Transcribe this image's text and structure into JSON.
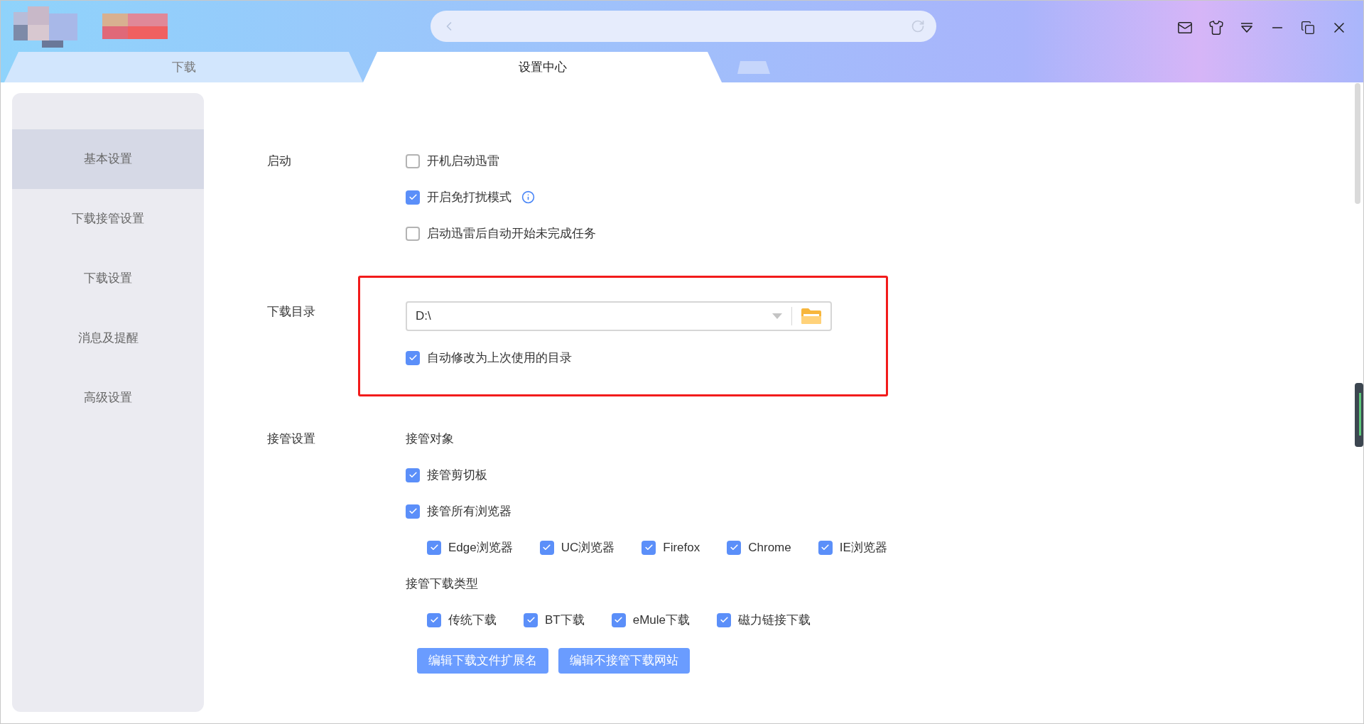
{
  "tabs": [
    {
      "label": "下载",
      "selected": false
    },
    {
      "label": "设置中心",
      "selected": true
    }
  ],
  "sidebar": {
    "items": [
      {
        "label": "基本设置",
        "selected": true
      },
      {
        "label": "下载接管设置",
        "selected": false
      },
      {
        "label": "下载设置",
        "selected": false
      },
      {
        "label": "消息及提醒",
        "selected": false
      },
      {
        "label": "高级设置",
        "selected": false
      }
    ]
  },
  "sections": [
    {
      "label": "启动",
      "highlighted": false,
      "rows": [
        {
          "kind": "checkbox",
          "label": "开机启动迅雷",
          "checked": false
        },
        {
          "kind": "checkbox",
          "label": "开启免打扰模式",
          "checked": true,
          "info": true
        },
        {
          "kind": "checkbox",
          "label": "启动迅雷后自动开始未完成任务",
          "checked": false
        }
      ]
    },
    {
      "label": "下载目录",
      "highlighted": true,
      "rows": [
        {
          "kind": "path",
          "value": "D:\\"
        },
        {
          "kind": "checkbox",
          "label": "自动修改为上次使用的目录",
          "checked": true
        }
      ]
    },
    {
      "label": "接管设置",
      "highlighted": false,
      "rows": [
        {
          "kind": "heading",
          "label": "接管对象"
        },
        {
          "kind": "checkbox",
          "label": "接管剪切板",
          "checked": true
        },
        {
          "kind": "checkbox",
          "label": "接管所有浏览器",
          "checked": true
        },
        {
          "kind": "inline",
          "items": [
            {
              "label": "Edge浏览器",
              "checked": true
            },
            {
              "label": "UC浏览器",
              "checked": true
            },
            {
              "label": "Firefox",
              "checked": true
            },
            {
              "label": "Chrome",
              "checked": true
            },
            {
              "label": "IE浏览器",
              "checked": true
            }
          ]
        },
        {
          "kind": "heading",
          "label": "接管下载类型"
        },
        {
          "kind": "inline",
          "items": [
            {
              "label": "传统下载",
              "checked": true
            },
            {
              "label": "BT下载",
              "checked": true
            },
            {
              "label": "eMule下载",
              "checked": true
            },
            {
              "label": "磁力链接下载",
              "checked": true
            }
          ]
        },
        {
          "kind": "buttons",
          "items": [
            "编辑下载文件扩展名",
            "编辑不接管下载网站"
          ]
        }
      ]
    }
  ]
}
